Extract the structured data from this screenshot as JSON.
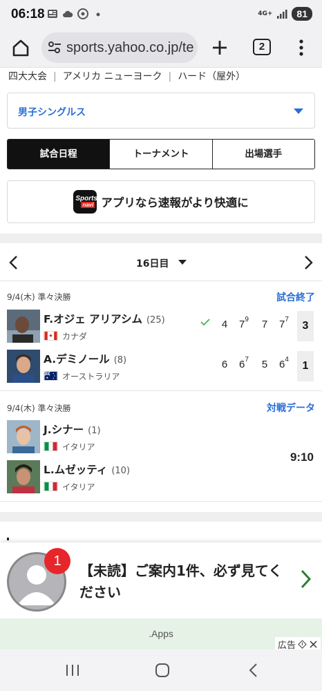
{
  "status_bar": {
    "time": "06:18",
    "network": "4G+",
    "battery": "81",
    "icons": [
      "news-icon",
      "cloud-icon",
      "chrome-icon",
      "dot-icon",
      "signal-icon"
    ]
  },
  "browser": {
    "url": "sports.yahoo.co.jp/te",
    "tab_count": "2"
  },
  "breadcrumb": [
    "四大大会",
    "アメリカ ニューヨーク",
    "ハード（屋外）"
  ],
  "event_select": {
    "selected": "男子シングルス"
  },
  "tabs": [
    {
      "label": "試合日程",
      "active": true
    },
    {
      "label": "トーナメント",
      "active": false
    },
    {
      "label": "出場選手",
      "active": false
    }
  ],
  "promo": {
    "logo_top": "Sports",
    "logo_bottom": "navi",
    "text": "アプリなら速報がより快適に"
  },
  "day_nav": {
    "label": "16日目"
  },
  "matches": [
    {
      "date": "9/4(木) 準々決勝",
      "status": "試合終了",
      "players": [
        {
          "name": "F.オジェ アリアシム",
          "seed": "(25)",
          "country": "カナダ",
          "winner": true,
          "sets": [
            {
              "score": "4",
              "tb": ""
            },
            {
              "score": "7",
              "tb": "9"
            },
            {
              "score": "7",
              "tb": ""
            },
            {
              "score": "7",
              "tb": "7"
            }
          ],
          "total": "3"
        },
        {
          "name": "A.デミノール",
          "seed": "(8)",
          "country": "オーストラリア",
          "winner": false,
          "sets": [
            {
              "score": "6",
              "tb": ""
            },
            {
              "score": "6",
              "tb": "7"
            },
            {
              "score": "5",
              "tb": ""
            },
            {
              "score": "6",
              "tb": "4"
            }
          ],
          "total": "1"
        }
      ]
    },
    {
      "date": "9/4(木) 準々決勝",
      "status": "対戦データ",
      "time": "9:10",
      "players": [
        {
          "name": "J.シナー",
          "seed": "(1)",
          "country": "イタリア"
        },
        {
          "name": "L.ムゼッティ",
          "seed": "(10)",
          "country": "イタリア"
        }
      ]
    }
  ],
  "ad": {
    "badge": "1",
    "text": "【未読】ご案内1件、必ず見てください",
    "strip": ".Apps",
    "label": "広告"
  },
  "colors": {
    "accent_blue": "#2a6fd6",
    "check_green": "#4caf50",
    "ad_badge_red": "#e7262b"
  }
}
